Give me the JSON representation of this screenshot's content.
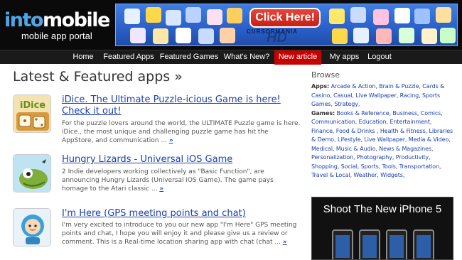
{
  "brand": {
    "logo_into": "into",
    "logo_mobile": "mobile",
    "tagline": "mobile app portal"
  },
  "banner": {
    "button_label": "Click Here!",
    "brand_text": "CURSORMANIA",
    "hd_text": "HD",
    "colors": {
      "bg": "#2a5fc8",
      "button": "#c71f17"
    }
  },
  "nav": {
    "items": [
      {
        "label": "Home"
      },
      {
        "label": "Featured Apps"
      },
      {
        "label": "Featured Games"
      },
      {
        "label": "What's New?"
      },
      {
        "label": "New article",
        "active": true
      },
      {
        "label": "My apps"
      },
      {
        "label": "Logout"
      }
    ],
    "active_color": "#c70000"
  },
  "main": {
    "title": "Latest & Featured apps »",
    "apps": [
      {
        "title": "iDice. The Ultimate Puzzle-icious Game is here! Check it out!",
        "description": "For the puzzle lovers around the world, the ULTIMATE Puzzle game is here. iDice., the most unique and challenging puzzle game has hit the AppStore, and communication ...",
        "more": "»",
        "icon": "idice-icon"
      },
      {
        "title": "Hungry Lizards - Universal iOS Game",
        "description": "2 Indie developers working collectively as \"Basic Function\", are announcing Hungry Lizards (Universal iOS Game). The game pays homage to the Atari classic ...",
        "more": "»",
        "icon": "lizard-icon"
      },
      {
        "title": "I'm Here (GPS meeting points and chat)",
        "description": "I'm very excited to introduce to you our new app \"I'm Here\" GPS meeting points and chat, I hope you will enjoy it and please give us a review or comment. This is a Real-time location sharing app with chat (chat ...",
        "more": "»",
        "icon": "astronaut-icon"
      }
    ],
    "link_color": "#1a3fb0"
  },
  "sidebar": {
    "browse_title": "Browse",
    "apps_label": "Apps:",
    "apps_links": "Arcade & Action, Brain & Puzzle, Cards & Casino, Casual, Live Wallpaper, Racing, Sports Games, Strategy,",
    "games_label": "Games:",
    "games_links": "Books & Reference, Business, Comics, Communication, Education, Entertainment, Finance, Food & Drinks , Health & Fitness, Libraries & Demo, Lifestyle, Live Wallpaper, Media & Video, Medical, Music & Audio, News & Magazines, Personalization, Photography, Productivity, Shopping, Social, Sports, Tools, Transportation, Travel & Local, Weather, Widgets,"
  },
  "ad": {
    "title": "Shoot The New iPhone 5"
  }
}
